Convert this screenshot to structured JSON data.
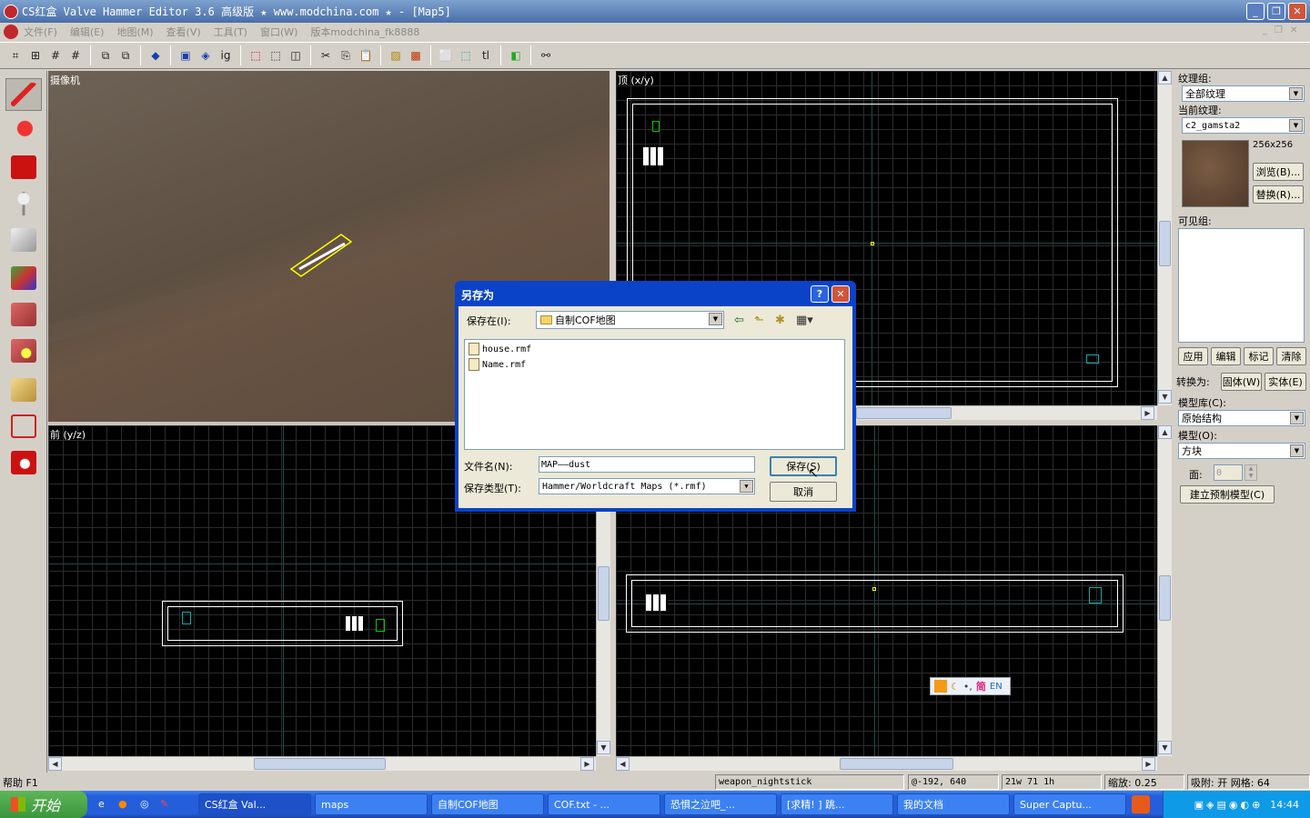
{
  "window": {
    "title": "CS红盒 Valve Hammer Editor 3.6 高级版 ★ www.modchina.com ★ - [Map5]"
  },
  "menu": {
    "items": [
      "文件(F)",
      "编辑(E)",
      "地图(M)",
      "查看(V)",
      "工具(T)",
      "窗口(W)",
      "版本modchina_fk8888"
    ]
  },
  "viewports": {
    "camera_label": "摄像机",
    "top_label": "顶 (x/y)",
    "front_label": "前 (y/z)"
  },
  "right_panel": {
    "texture_group_label": "纹理组:",
    "texture_group_value": "全部纹理",
    "current_texture_label": "当前纹理:",
    "current_texture_value": "c2_gamsta2",
    "texture_size": "256x256",
    "browse_button": "浏览(B)...",
    "replace_button": "替换(R)...",
    "visgroup_label": "可见组:",
    "apply_button": "应用",
    "edit_button": "编辑",
    "mark_button": "标记",
    "clear_button": "清除",
    "convert_label": "转换为:",
    "to_world_button": "固体(W)",
    "to_entity_button": "实体(E)",
    "prefab_lib_label": "模型库(C):",
    "prefab_lib_value": "原始结构",
    "prefab_label": "模型(O):",
    "prefab_value": "方块",
    "faces_label": "面:",
    "faces_value": "0",
    "create_prefab_button": "建立预制模型(C)"
  },
  "dialog": {
    "title": "另存为",
    "save_in_label": "保存在(I):",
    "save_in_value": "自制COF地图",
    "files": [
      "house.rmf",
      "Name.rmf"
    ],
    "filename_label": "文件名(N):",
    "filename_value": "MAP——dust",
    "filetype_label": "保存类型(T):",
    "filetype_value": "Hammer/Worldcraft Maps (*.rmf)",
    "save_button": "保存(S)",
    "cancel_button": "取消"
  },
  "ime_bar": {
    "mode": "简",
    "lang": "EN"
  },
  "status": {
    "help": "帮助 F1",
    "entity": "weapon_nightstick",
    "coords": "@-192, 640",
    "dims": "21w 71 1h",
    "zoom": "缩放: 0.25",
    "snap": "吸附: 开 网格: 64"
  },
  "taskbar": {
    "start": "开始",
    "tasks": [
      "CS红盒 Val...",
      "maps",
      "自制COF地图",
      "COF.txt - ...",
      "恐惧之泣吧_...",
      "[求精! ] 跳...",
      "我的文档",
      "Super Captu..."
    ],
    "clock": "14:44"
  }
}
